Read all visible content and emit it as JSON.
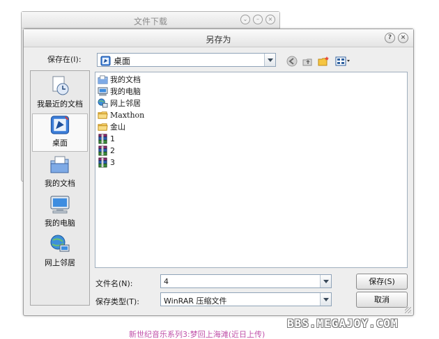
{
  "background_dialog": {
    "title": "文件下载"
  },
  "dialog": {
    "title": "另存为",
    "help_icon": "help-icon",
    "close_icon": "close-icon"
  },
  "save_in": {
    "label": "保存在(I):",
    "value": "桌面"
  },
  "places": [
    {
      "label": "我最近的文档",
      "icon": "recent-documents-icon"
    },
    {
      "label": "桌面",
      "icon": "desktop-icon",
      "selected": true
    },
    {
      "label": "我的文档",
      "icon": "my-documents-icon"
    },
    {
      "label": "我的电脑",
      "icon": "my-computer-icon"
    },
    {
      "label": "网上邻居",
      "icon": "network-places-icon"
    }
  ],
  "files": [
    {
      "name": "我的文档",
      "icon": "my-documents-icon"
    },
    {
      "name": "我的电脑",
      "icon": "my-computer-icon"
    },
    {
      "name": "网上邻居",
      "icon": "network-places-icon"
    },
    {
      "name": "Maxthon",
      "icon": "folder-icon"
    },
    {
      "name": "金山",
      "icon": "folder-icon"
    },
    {
      "name": "1",
      "icon": "winrar-archive-icon"
    },
    {
      "name": "2",
      "icon": "winrar-archive-icon"
    },
    {
      "name": "3",
      "icon": "winrar-archive-icon"
    }
  ],
  "filename": {
    "label": "文件名(N):",
    "value": "4"
  },
  "filetype": {
    "label": "保存类型(T):",
    "value": "WinRAR 压缩文件"
  },
  "buttons": {
    "save": "保存(S)",
    "cancel": "取消"
  },
  "caption": "新世纪音乐系列3:梦回上海滩(近日上传)",
  "watermark": "BBS.MEGAJOY.COM",
  "colors": {
    "caption": "#c050a8",
    "selection_bg": "#f9f9f9",
    "dialog_bg": "#eeeeee"
  }
}
